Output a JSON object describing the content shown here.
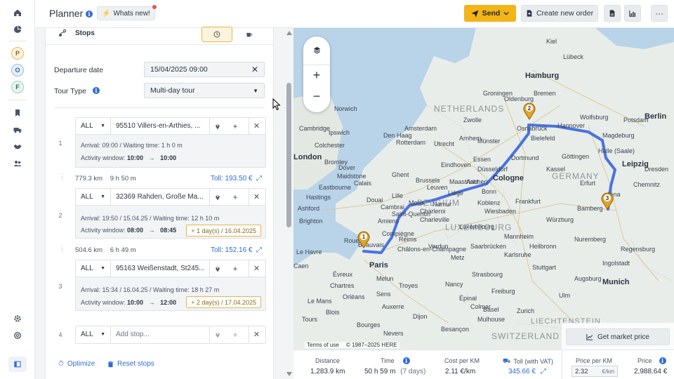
{
  "header": {
    "title": "Planner",
    "whats_new": "Whats new!",
    "send": "Send",
    "create_order": "Create new order"
  },
  "rail": {
    "avatars": [
      "P",
      "O",
      "F"
    ]
  },
  "stops": {
    "title": "Stops",
    "departure_label": "Departure date",
    "departure_value": "15/04/2025 09:00",
    "tour_type_label": "Tour Type",
    "tour_type_value": "Multi-day tour",
    "items": [
      {
        "num": "1",
        "filter": "ALL",
        "address": "95510 Villers-en-Arthies, ...",
        "arrival": "Arrival: 09:00 / Waiting time: 1 h 0 m",
        "window_label": "Activity window:",
        "window_from": "10:00",
        "window_to": "10:00",
        "extra": ""
      },
      {
        "num": "2",
        "filter": "ALL",
        "address": "32369 Rahden, Große Ma...",
        "arrival": "Arrival: 19:50 / 15.04.25 / Waiting time: 12 h 10 m",
        "window_label": "Activity window:",
        "window_from": "08:00",
        "window_to": "08:45",
        "extra": "+ 1 day(s) / 16.04.2025"
      },
      {
        "num": "3",
        "filter": "ALL",
        "address": "95163 Weißenstadt, St245...",
        "arrival": "Arrival: 15:34 / 16.04.25 / Waiting time: 18 h 27 m",
        "window_label": "Activity window:",
        "window_from": "10:00",
        "window_to": "12:00",
        "extra": "+ 2 day(s) / 17.04.2025"
      }
    ],
    "legs": [
      {
        "distance": "779.3 km",
        "duration": "9 h 50 m",
        "toll": "Toll: 193.50 €"
      },
      {
        "distance": "504.6 km",
        "duration": "6 h 49 m",
        "toll": "Toll: 152.16 €"
      }
    ],
    "new_stop": {
      "num": "4",
      "filter": "ALL",
      "placeholder": "Add stop..."
    },
    "optimize": "Optimize",
    "reset": "Reset stops"
  },
  "map": {
    "countries": {
      "netherlands": "NETHERLANDS",
      "belgium": "BELGIUM",
      "luxembourg": "LUXEMBOURG",
      "germany": "GERMANY",
      "liechtenstein": "LIECHTENSTEIN",
      "switzerland": "SWITZERLAND"
    },
    "cities_big": {
      "hamburg": "Hamburg",
      "berlin": "Berlin",
      "cologne": "Cologne",
      "leipzig": "Leipzig",
      "munich": "Munich",
      "paris": "Paris",
      "london": "London"
    },
    "cities": {
      "bremen": "Bremen",
      "amsterdam": "Amsterdam",
      "utrecht": "Utrecht",
      "rotterdam": "Rotterdam",
      "osnabrueck": "Osnabrück",
      "bielefeld": "Bielefeld",
      "muenster": "Münster",
      "dortmund": "Dortmund",
      "essen": "Essen",
      "duesseldorf": "Düsseldorf",
      "goettingen": "Göttingen",
      "magdeburg": "Magdeburg",
      "halle": "Halle (Saale)",
      "chemnitz": "Chemnitz",
      "erfurt": "Erfurt",
      "ghent": "Ghent",
      "brussels": "Brussels",
      "liege": "Liège",
      "wiesbaden": "Wiesbaden",
      "mannheim": "Mannheim",
      "nuremberg": "Nuremberg",
      "stuttgart": "Stuttgart",
      "strasbourg": "Strasbourg",
      "amiens": "Amiens",
      "reims": "Reims",
      "metz": "Metz",
      "rouen": "Rouen",
      "calais": "Calais",
      "lille": "Lille",
      "ingolstadt": "Ingolstadt",
      "augsburg": "Augsburg",
      "brighton": "Brighton",
      "ipswich": "Ipswich",
      "norwich": "Norwich",
      "cambridge": "Cambridge",
      "hannover": "Hannover",
      "wolfsburg": "Wolfsburg",
      "leuven": "Leuven",
      "eindhoven": "Eindhoven",
      "zwolle": "Zwolle",
      "groningen": "Groningen",
      "kassel": "Kassel",
      "luxembourg": "Luxembourg",
      "nancy": "Nancy",
      "troyes": "Troyes",
      "orleans": "Orléans",
      "le_mans": "Le Mans",
      "dijon": "Dijon",
      "basel": "Basel",
      "zurich": "Zurich",
      "freiburg": "Freiburg",
      "regensburg": "Regensburg",
      "wuerzburg": "Würzburg",
      "frankfurt": "Frankfurt",
      "bonn": "Bonn",
      "koblenz": "Koblenz",
      "saarbruecken": "Saarbrücken",
      "karlsruhe": "Karlsruhe",
      "heilbronn": "Heilbronn",
      "ulm": "Ulm",
      "bamberg": "Bamberg",
      "jena": "Jena",
      "dresden": "Dresden",
      "potsdam": "Potsdam",
      "lubeck": "Lübeck",
      "kiel": "Kiel",
      "oldenburg": "Oldenburg",
      "den_haag": "Den Haag",
      "arnhem": "Arnhem",
      "maastricht": "Maastricht",
      "aachen": "Aachen",
      "charleville": "Charleville",
      "chalons": "Châlons-en-Champagne",
      "colchester": "Colchester",
      "dover": "Dover",
      "bromley": "Bromley",
      "maidstone": "Maidstone",
      "eastbourne": "Eastbourne",
      "hastings": "Hastings",
      "ashford": "Ashford",
      "le_havre": "Le Havre",
      "caen": "Caen",
      "evreux": "Évreux",
      "beauvais": "Beauvais",
      "compiegne": "Compiègne",
      "saint_quentin": "Saint-Quentin",
      "cambrai": "Cambrai",
      "douai": "Douai",
      "mons": "Mons",
      "namur": "Namur",
      "charleroi": "Charleroi",
      "verdun": "Verdun",
      "epinal": "Épinal",
      "mulhouse": "Mulhouse",
      "colmar": "Colmar",
      "besancon": "Besançon",
      "auxerre": "Auxerre",
      "sens": "Sens",
      "melun": "Melun",
      "chartres": "Chartres",
      "blois": "Blois",
      "tours": "Tours",
      "bourges": "Bourges",
      "nevers": "Nevers"
    },
    "layers_icon": "layers-icon",
    "zoom_in": "+",
    "zoom_out": "−",
    "terms": "Terms of use",
    "copyright": "© 1987–2025 HERE",
    "market_price_btn": "Get market price",
    "route_color": "#4a72e0",
    "pin_color": "#e2a526",
    "pins": [
      "1",
      "2",
      "3"
    ]
  },
  "stats": {
    "distance_label": "Distance",
    "distance": "1,283.9 km",
    "time_label": "Time",
    "time": "50 h 59 m",
    "time_days": "(7 days)",
    "cpk_label": "Cost per KM",
    "cpk": "2.11 €/km",
    "toll_label": "Toll (with VAT)",
    "toll": "345.66 €",
    "ppk_label": "Price per KM",
    "ppk_value": "2.32",
    "ppk_unit": "€/km",
    "price_label": "Price",
    "price": "2,988.64 €"
  },
  "colors": {
    "accent_yellow": "#f3b417",
    "link_blue": "#2f6bd8",
    "extra_border": "#e7b54a"
  }
}
